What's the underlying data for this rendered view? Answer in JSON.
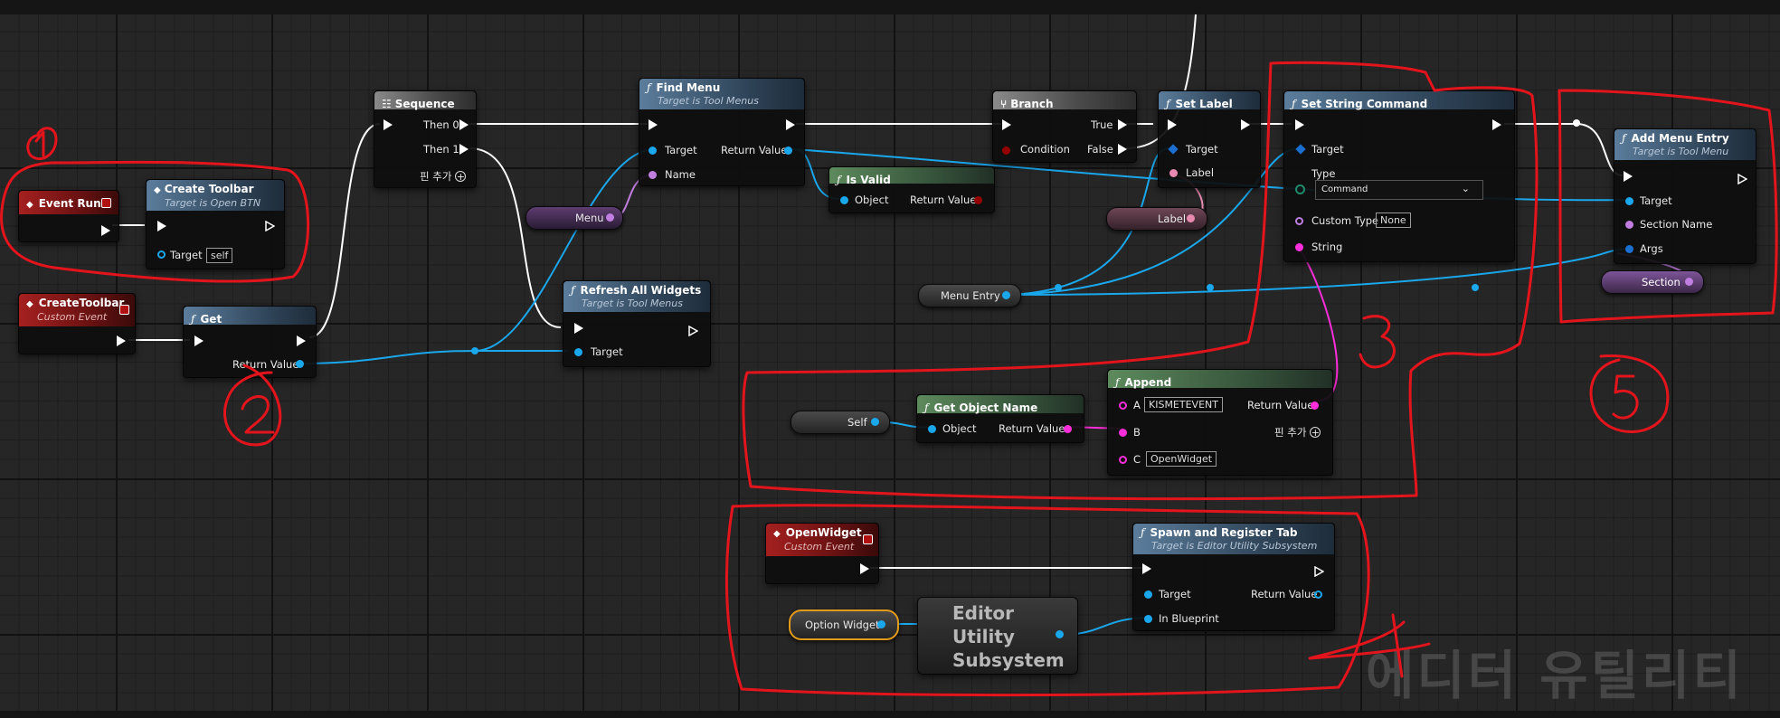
{
  "nodes": {
    "event_run": {
      "title": "Event Run"
    },
    "create_toolbar": {
      "title": "Create Toolbar",
      "subtitle": "Target is Open BTN",
      "target_label": "Target",
      "target_value": "self"
    },
    "create_toolbar_event": {
      "title": "CreateToolbar",
      "subtitle": "Custom Event"
    },
    "get": {
      "title": "Get",
      "return_label": "Return Value"
    },
    "sequence": {
      "title": "Sequence",
      "then0": "Then 0",
      "then1": "Then 1",
      "add_pin": "핀 추가"
    },
    "find_menu": {
      "title": "Find Menu",
      "subtitle": "Target is Tool Menus",
      "target_label": "Target",
      "name_label": "Name",
      "return_label": "Return Value"
    },
    "menu_var": {
      "label": "Menu"
    },
    "refresh_all": {
      "title": "Refresh All Widgets",
      "subtitle": "Target is Tool Menus",
      "target_label": "Target"
    },
    "is_valid": {
      "title": "Is Valid",
      "object_label": "Object",
      "return_label": "Return Value"
    },
    "branch": {
      "title": "Branch",
      "true_label": "True",
      "false_label": "False",
      "condition_label": "Condition"
    },
    "set_label": {
      "title": "Set Label",
      "target_label": "Target",
      "label_label": "Label"
    },
    "label_var": {
      "label": "Label"
    },
    "set_string_command": {
      "title": "Set String Command",
      "target_label": "Target",
      "type_label": "Type",
      "type_value": "Command",
      "custom_type_label": "Custom Type",
      "custom_type_value": "None",
      "string_label": "String"
    },
    "add_menu_entry": {
      "title": "Add Menu Entry",
      "subtitle": "Target is Tool Menu",
      "target_label": "Target",
      "section_name_label": "Section Name",
      "args_label": "Args"
    },
    "section_var": {
      "label": "Section"
    },
    "menu_entry_var": {
      "label": "Menu Entry"
    },
    "self_var": {
      "label": "Self"
    },
    "get_object_name": {
      "title": "Get Object Name",
      "object_label": "Object",
      "return_label": "Return Value"
    },
    "append": {
      "title": "Append",
      "a_label": "A",
      "a_value": "KISMETEVENT",
      "b_label": "B",
      "c_label": "C",
      "c_value": "OpenWidget",
      "return_label": "Return Value",
      "add_pin": "핀 추가"
    },
    "open_widget_event": {
      "title": "OpenWidget",
      "subtitle": "Custom Event"
    },
    "spawn_register": {
      "title": "Spawn and Register Tab",
      "subtitle": "Target is Editor Utility Subsystem",
      "target_label": "Target",
      "in_blueprint_label": "In Blueprint",
      "return_label": "Return Value"
    },
    "option_widget_var": {
      "label": "Option Widget"
    },
    "eus_node": {
      "line1": "Editor",
      "line2": "Utility",
      "line3": "Subsystem"
    }
  },
  "watermark": "에디터 유틸리티",
  "colors": {
    "exec": "#ffffff",
    "object": "#1aa7ec",
    "string": "#ff2edb",
    "name": "#c07ee0",
    "text": "#e88ab0",
    "bool": "#950000",
    "annotation": "#e3141c"
  }
}
